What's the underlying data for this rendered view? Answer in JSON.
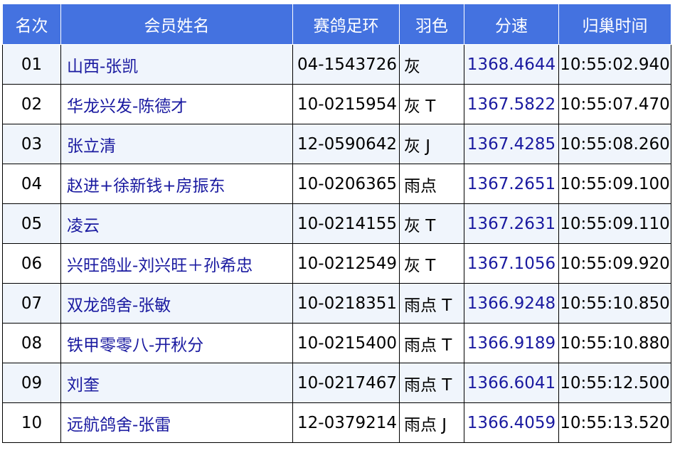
{
  "headers": {
    "rank": "名次",
    "name": "会员姓名",
    "ring": "赛鸽足环",
    "color": "羽色",
    "speed": "分速",
    "time": "归巢时间"
  },
  "rows": [
    {
      "rank": "01",
      "name": "山西-张凯",
      "ring": "04-1543726",
      "color": "灰",
      "speed": "1368.4644",
      "time": "10:55:02.940"
    },
    {
      "rank": "02",
      "name": "华龙兴发-陈德才",
      "ring": "10-0215954",
      "color": "灰 T",
      "speed": "1367.5822",
      "time": "10:55:07.470"
    },
    {
      "rank": "03",
      "name": "张立清",
      "ring": "12-0590642",
      "color": "灰 J",
      "speed": "1367.4285",
      "time": "10:55:08.260"
    },
    {
      "rank": "04",
      "name": "赵进+徐新钱+房振东",
      "ring": "10-0206365",
      "color": "雨点",
      "speed": "1367.2651",
      "time": "10:55:09.100"
    },
    {
      "rank": "05",
      "name": "凌云",
      "ring": "10-0214155",
      "color": "灰 T",
      "speed": "1367.2631",
      "time": "10:55:09.110"
    },
    {
      "rank": "06",
      "name": "兴旺鸽业-刘兴旺＋孙希忠",
      "ring": "10-0212549",
      "color": "灰 T",
      "speed": "1367.1056",
      "time": "10:55:09.920"
    },
    {
      "rank": "07",
      "name": "双龙鸽舍-张敏",
      "ring": "10-0218351",
      "color": "雨点 T",
      "speed": "1366.9248",
      "time": "10:55:10.850"
    },
    {
      "rank": "08",
      "name": "铁甲零零八-开秋分",
      "ring": "10-0215400",
      "color": "雨点 T",
      "speed": "1366.9189",
      "time": "10:55:10.880"
    },
    {
      "rank": "09",
      "name": "刘奎",
      "ring": "10-0217467",
      "color": "雨点 T",
      "speed": "1366.6041",
      "time": "10:55:12.500"
    },
    {
      "rank": "10",
      "name": "远航鸽舍-张雷",
      "ring": "12-0379214",
      "color": "雨点 J",
      "speed": "1366.4059",
      "time": "10:55:13.520"
    }
  ],
  "colors": {
    "header_bg": "#4472e0",
    "header_text": "#ffffff",
    "row_alt_bg": "#f0f5fc",
    "name_text": "#1a1aa0",
    "speed_text": "#1a1aa0"
  }
}
